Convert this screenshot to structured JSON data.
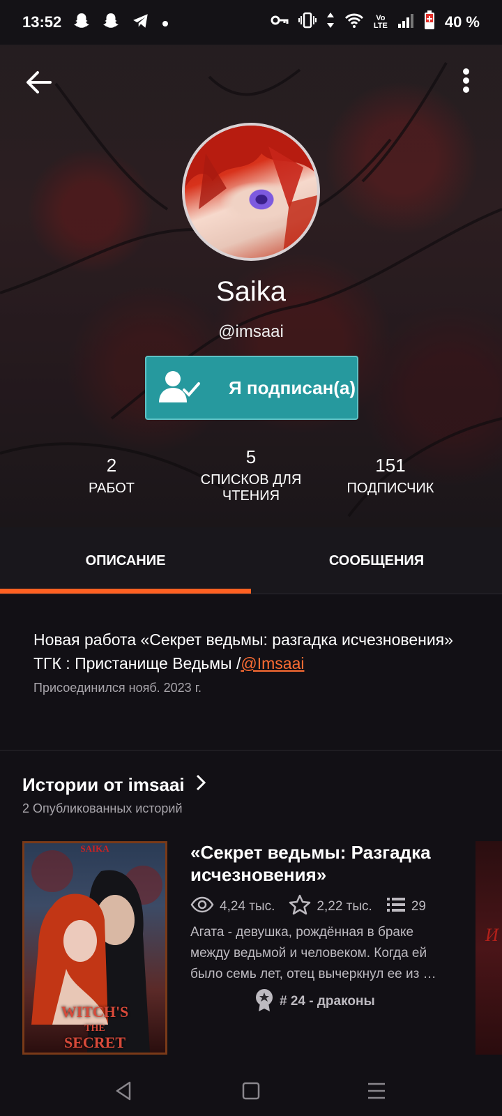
{
  "status_bar": {
    "time": "13:52",
    "battery": "40 %",
    "icons": [
      "snapchat-icon",
      "snapchat-icon",
      "telegram-icon",
      "dot-icon",
      "key-icon",
      "vibrate-icon",
      "data-icon",
      "wifi-icon",
      "volte-icon",
      "signal-icon",
      "battery-icon"
    ]
  },
  "profile": {
    "display_name": "Saika",
    "username": "@imsaai",
    "follow_label": "Я подписан(а)",
    "stats": [
      {
        "value": "2",
        "label": "РАБОТ"
      },
      {
        "value": "5",
        "label_line1": "СПИСКОВ ДЛЯ",
        "label_line2": "ЧТЕНИЯ"
      },
      {
        "value": "151",
        "label": "ПОДПИСЧИК"
      }
    ]
  },
  "tabs": {
    "about": "ОПИСАНИЕ",
    "messages": "СООБЩЕНИЯ",
    "active": "about"
  },
  "about": {
    "bio_text": "Новая работа «Секрет ведьмы: разгадка исчезновения» ТГК : Пристанище Ведьмы /",
    "bio_link": "@Imsaai",
    "joined": "Присоединился нояб. 2023 г."
  },
  "stories": {
    "title": "Истории от imsaai",
    "subtitle": "2 Опубликованных историй",
    "items": [
      {
        "title": "«Секрет ведьмы: Разгадка исчезновения»",
        "views": "4,24 тыс.",
        "votes": "2,22 тыс.",
        "parts": "29",
        "description": "Агата - девушка, рождённая в браке между ведьмой и человеком. Когда ей было семь лет, отец вычеркнул ее из …",
        "rank": "# 24 - драконы",
        "cover_top": "SAIKA",
        "cover_title_1": "WITCH'S",
        "cover_title_2": "THE",
        "cover_title_3": "SECRET"
      }
    ],
    "next_cover_text": "И"
  },
  "colors": {
    "accent": "#ff6122",
    "follow_button": "#26999e",
    "link": "#ff6d33"
  }
}
